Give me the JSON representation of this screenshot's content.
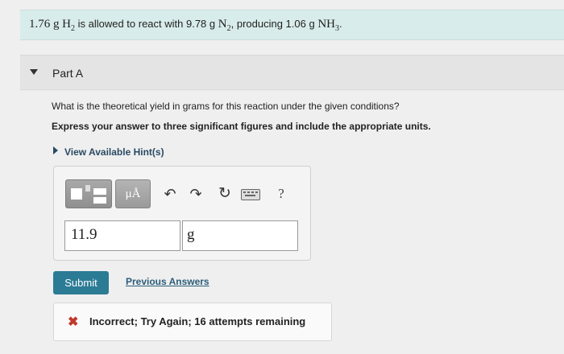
{
  "problem": {
    "lead_mass": "1.76 g",
    "reactant1": "H",
    "reactant1_sub": "2",
    "mid_text": "is allowed to react with 9.78 g",
    "reactant2": "N",
    "reactant2_sub": "2",
    "producing_text": ", producing 1.06 g",
    "product": "NH",
    "product_sub": "3",
    "end": "."
  },
  "part": {
    "title": "Part A",
    "question": "What is the theoretical yield in grams for this reaction under the given conditions?",
    "instruction": "Express your answer to three significant figures and include the appropriate units.",
    "hints_label": "View Available Hint(s)"
  },
  "toolbar": {
    "templates_icon": "templates-icon",
    "units_label": "μÅ",
    "undo_glyph": "↶",
    "redo_glyph": "↷",
    "reset_glyph": "↻",
    "help_label": "?"
  },
  "answer": {
    "value": "11.9",
    "units": "g"
  },
  "actions": {
    "submit_label": "Submit",
    "previous_answers_label": "Previous Answers"
  },
  "feedback": {
    "icon": "✖",
    "message": "Incorrect; Try Again; 16 attempts remaining"
  },
  "colors": {
    "banner": "#d8eceb",
    "submit": "#2c7b95",
    "error": "#c0392b"
  }
}
